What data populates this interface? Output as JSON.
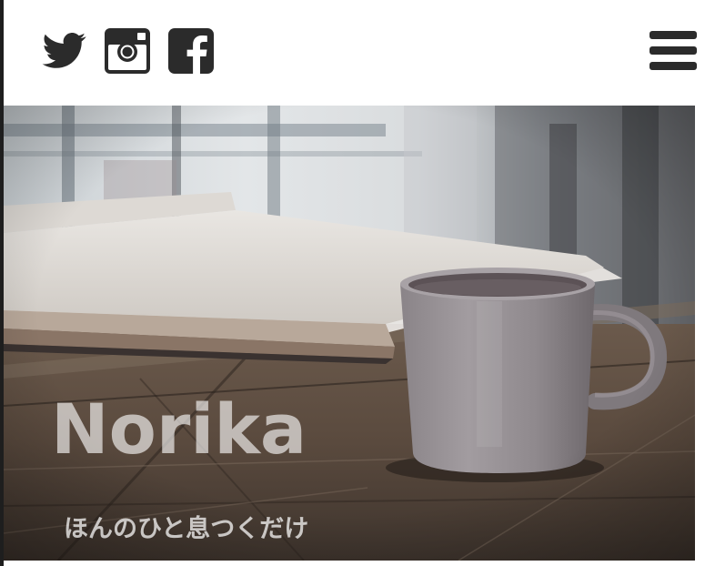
{
  "header": {
    "social_icons": [
      "twitter-icon",
      "instagram-icon",
      "facebook-icon"
    ],
    "menu_icon": "hamburger-menu-icon",
    "icon_color": "#2b2b2b"
  },
  "hero": {
    "title": "Norika",
    "subtitle": "ほんのひと息つくだけ"
  }
}
